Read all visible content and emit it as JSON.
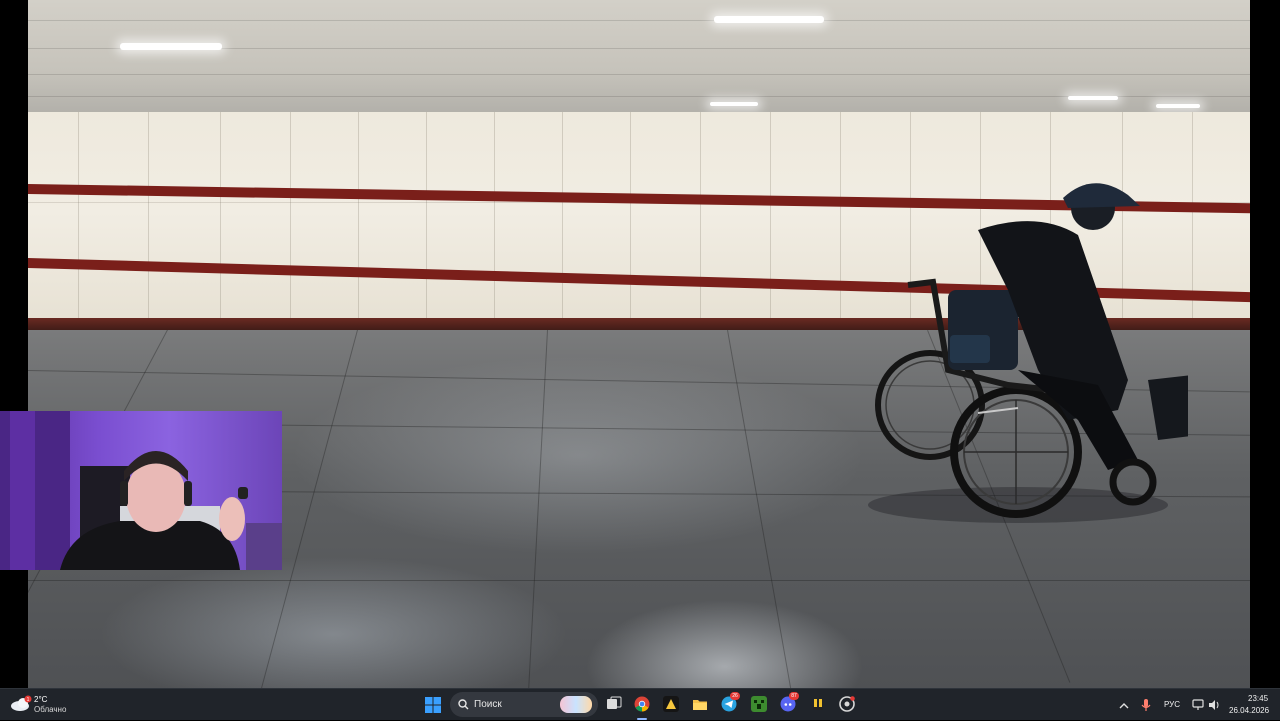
{
  "taskbar": {
    "weather": {
      "temperature": "2°C",
      "condition": "Облачно",
      "icon": "cloudy-weather-icon"
    },
    "search": {
      "placeholder": "Поиск",
      "icon": "search-icon"
    },
    "apps": [
      {
        "name": "start",
        "icon": "windows-start-icon"
      },
      {
        "name": "task-view",
        "icon": "task-view-icon"
      },
      {
        "name": "chrome",
        "icon": "chrome-icon",
        "badge": ""
      },
      {
        "name": "media",
        "icon": "media-app-icon"
      },
      {
        "name": "explorer",
        "icon": "folder-icon"
      },
      {
        "name": "telegram",
        "icon": "telegram-icon",
        "badge": "26"
      },
      {
        "name": "minecraft",
        "icon": "minecraft-icon"
      },
      {
        "name": "discord",
        "icon": "discord-icon",
        "badge": "87"
      },
      {
        "name": "tools",
        "icon": "tools-icon"
      },
      {
        "name": "obs",
        "icon": "recording-icon"
      }
    ],
    "tray": {
      "language": "РУС",
      "time": "23:45",
      "date": "26.04.2026"
    }
  },
  "colors": {
    "taskbar_bg": "#20242a",
    "accent_blue": "#1e88e5",
    "wall_stripe": "#7a1f1a",
    "webcam_bg": "#7a4ed0"
  }
}
